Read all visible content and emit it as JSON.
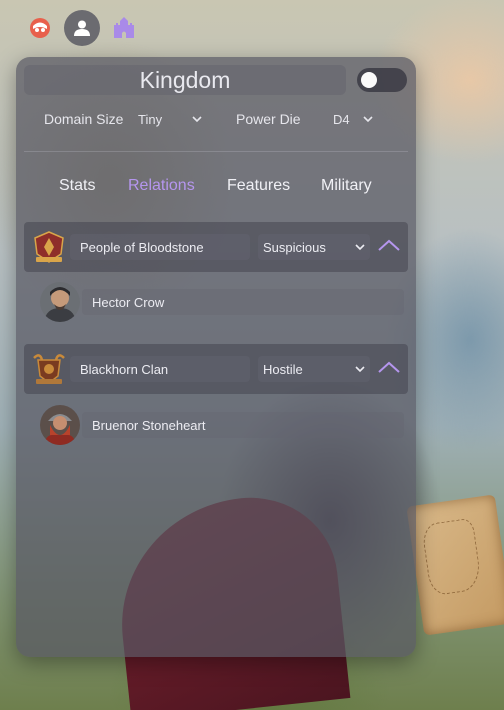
{
  "app_icons": [
    {
      "icon": "hooded-face-icon",
      "color": "#e8604c"
    },
    {
      "icon": "person-icon",
      "color": "#ffffff"
    },
    {
      "icon": "castle-icon",
      "color": "#a98ae8"
    }
  ],
  "panel": {
    "title": "Kingdom",
    "toggle_on": false,
    "domain_size_label": "Domain Size",
    "domain_size_value": "Tiny",
    "power_die_label": "Power Die",
    "power_die_value": "D4"
  },
  "tabs": [
    {
      "label": "Stats",
      "active": false
    },
    {
      "label": "Relations",
      "active": true
    },
    {
      "label": "Features",
      "active": false
    },
    {
      "label": "Military",
      "active": false
    }
  ],
  "factions": [
    {
      "name": "People of Bloodstone",
      "attitude": "Suspicious",
      "crest_icon": "crest-icon",
      "members": [
        {
          "name": "Hector Crow",
          "portrait_icon": "portrait-icon"
        }
      ]
    },
    {
      "name": "Blackhorn Clan",
      "attitude": "Hostile",
      "crest_icon": "crest-icon",
      "members": [
        {
          "name": "Bruenor Stoneheart",
          "portrait_icon": "portrait-icon"
        }
      ]
    }
  ],
  "colors": {
    "accent": "#b596ee",
    "panel": "#585862"
  }
}
